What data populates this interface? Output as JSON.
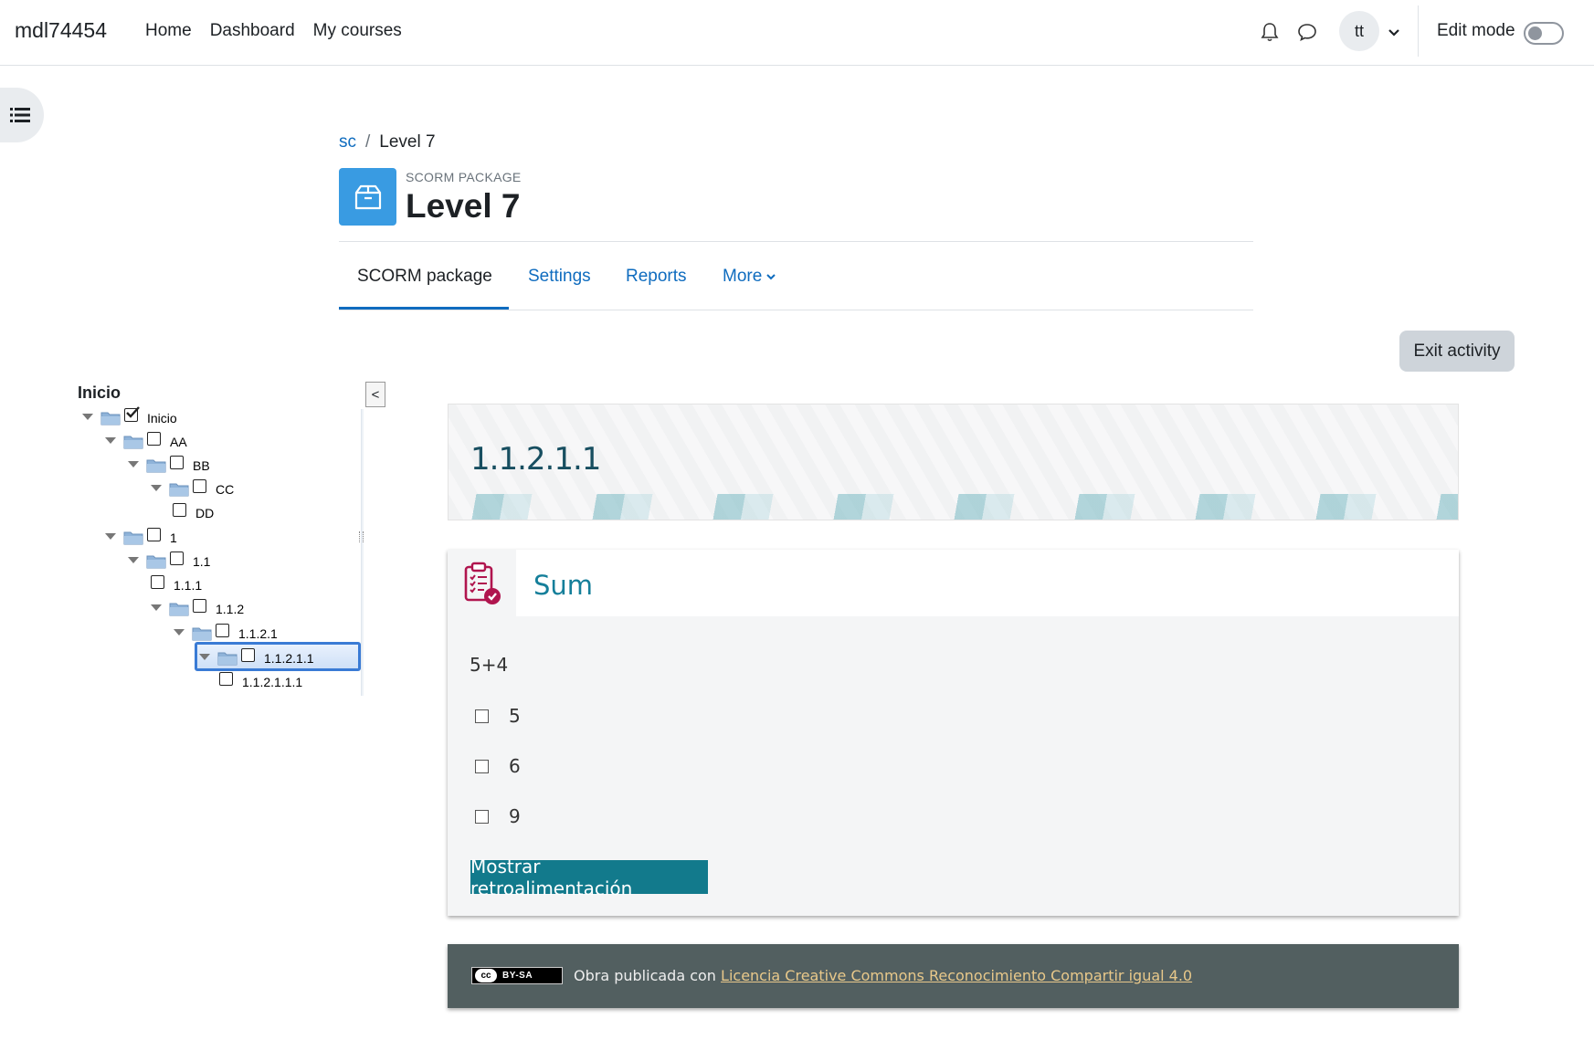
{
  "navbar": {
    "brand": "mdl74454",
    "links": [
      "Home",
      "Dashboard",
      "My courses"
    ],
    "avatar_initials": "tt",
    "edit_mode_label": "Edit mode",
    "edit_mode_on": false
  },
  "breadcrumb": {
    "parent": "sc",
    "separator": "/",
    "current": "Level 7"
  },
  "activity": {
    "kind": "SCORM PACKAGE",
    "title": "Level 7",
    "icon": "package-icon",
    "icon_color": "#399be2"
  },
  "tabs": [
    {
      "label": "SCORM package",
      "active": true
    },
    {
      "label": "Settings",
      "active": false
    },
    {
      "label": "Reports",
      "active": false
    },
    {
      "label": "More",
      "active": false
    }
  ],
  "exit_button": "Exit activity",
  "toc": {
    "title": "Inicio",
    "collapse_label": "<",
    "nodes": [
      {
        "label": "Inicio",
        "checked": true
      },
      {
        "label": "AA",
        "checked": false
      },
      {
        "label": "BB",
        "checked": false
      },
      {
        "label": "CC",
        "checked": false
      },
      {
        "label": "DD",
        "checked": false
      },
      {
        "label": "1",
        "checked": false
      },
      {
        "label": "1.1",
        "checked": false
      },
      {
        "label": "1.1.1",
        "checked": false
      },
      {
        "label": "1.1.2",
        "checked": false
      },
      {
        "label": "1.1.2.1",
        "checked": false
      },
      {
        "label": "1.1.2.1.1",
        "checked": false,
        "selected": true
      },
      {
        "label": "1.1.2.1.1.1",
        "checked": false
      }
    ]
  },
  "content": {
    "banner_title": "1.1.2.1.1",
    "question": {
      "title": "Sum",
      "text": "5+4",
      "options": [
        "5",
        "6",
        "9"
      ],
      "feedback_button": "Mostrar retroalimentación"
    },
    "license": {
      "badge_cc": "cc",
      "badge_by": "BY-SA",
      "prefix": "Obra publicada con",
      "link": "Licencia Creative Commons Reconocimiento Compartir igual 4.0"
    }
  },
  "colors": {
    "link": "#0f6cbf",
    "accent_teal": "#127a8c",
    "license_bg": "#525f60"
  }
}
